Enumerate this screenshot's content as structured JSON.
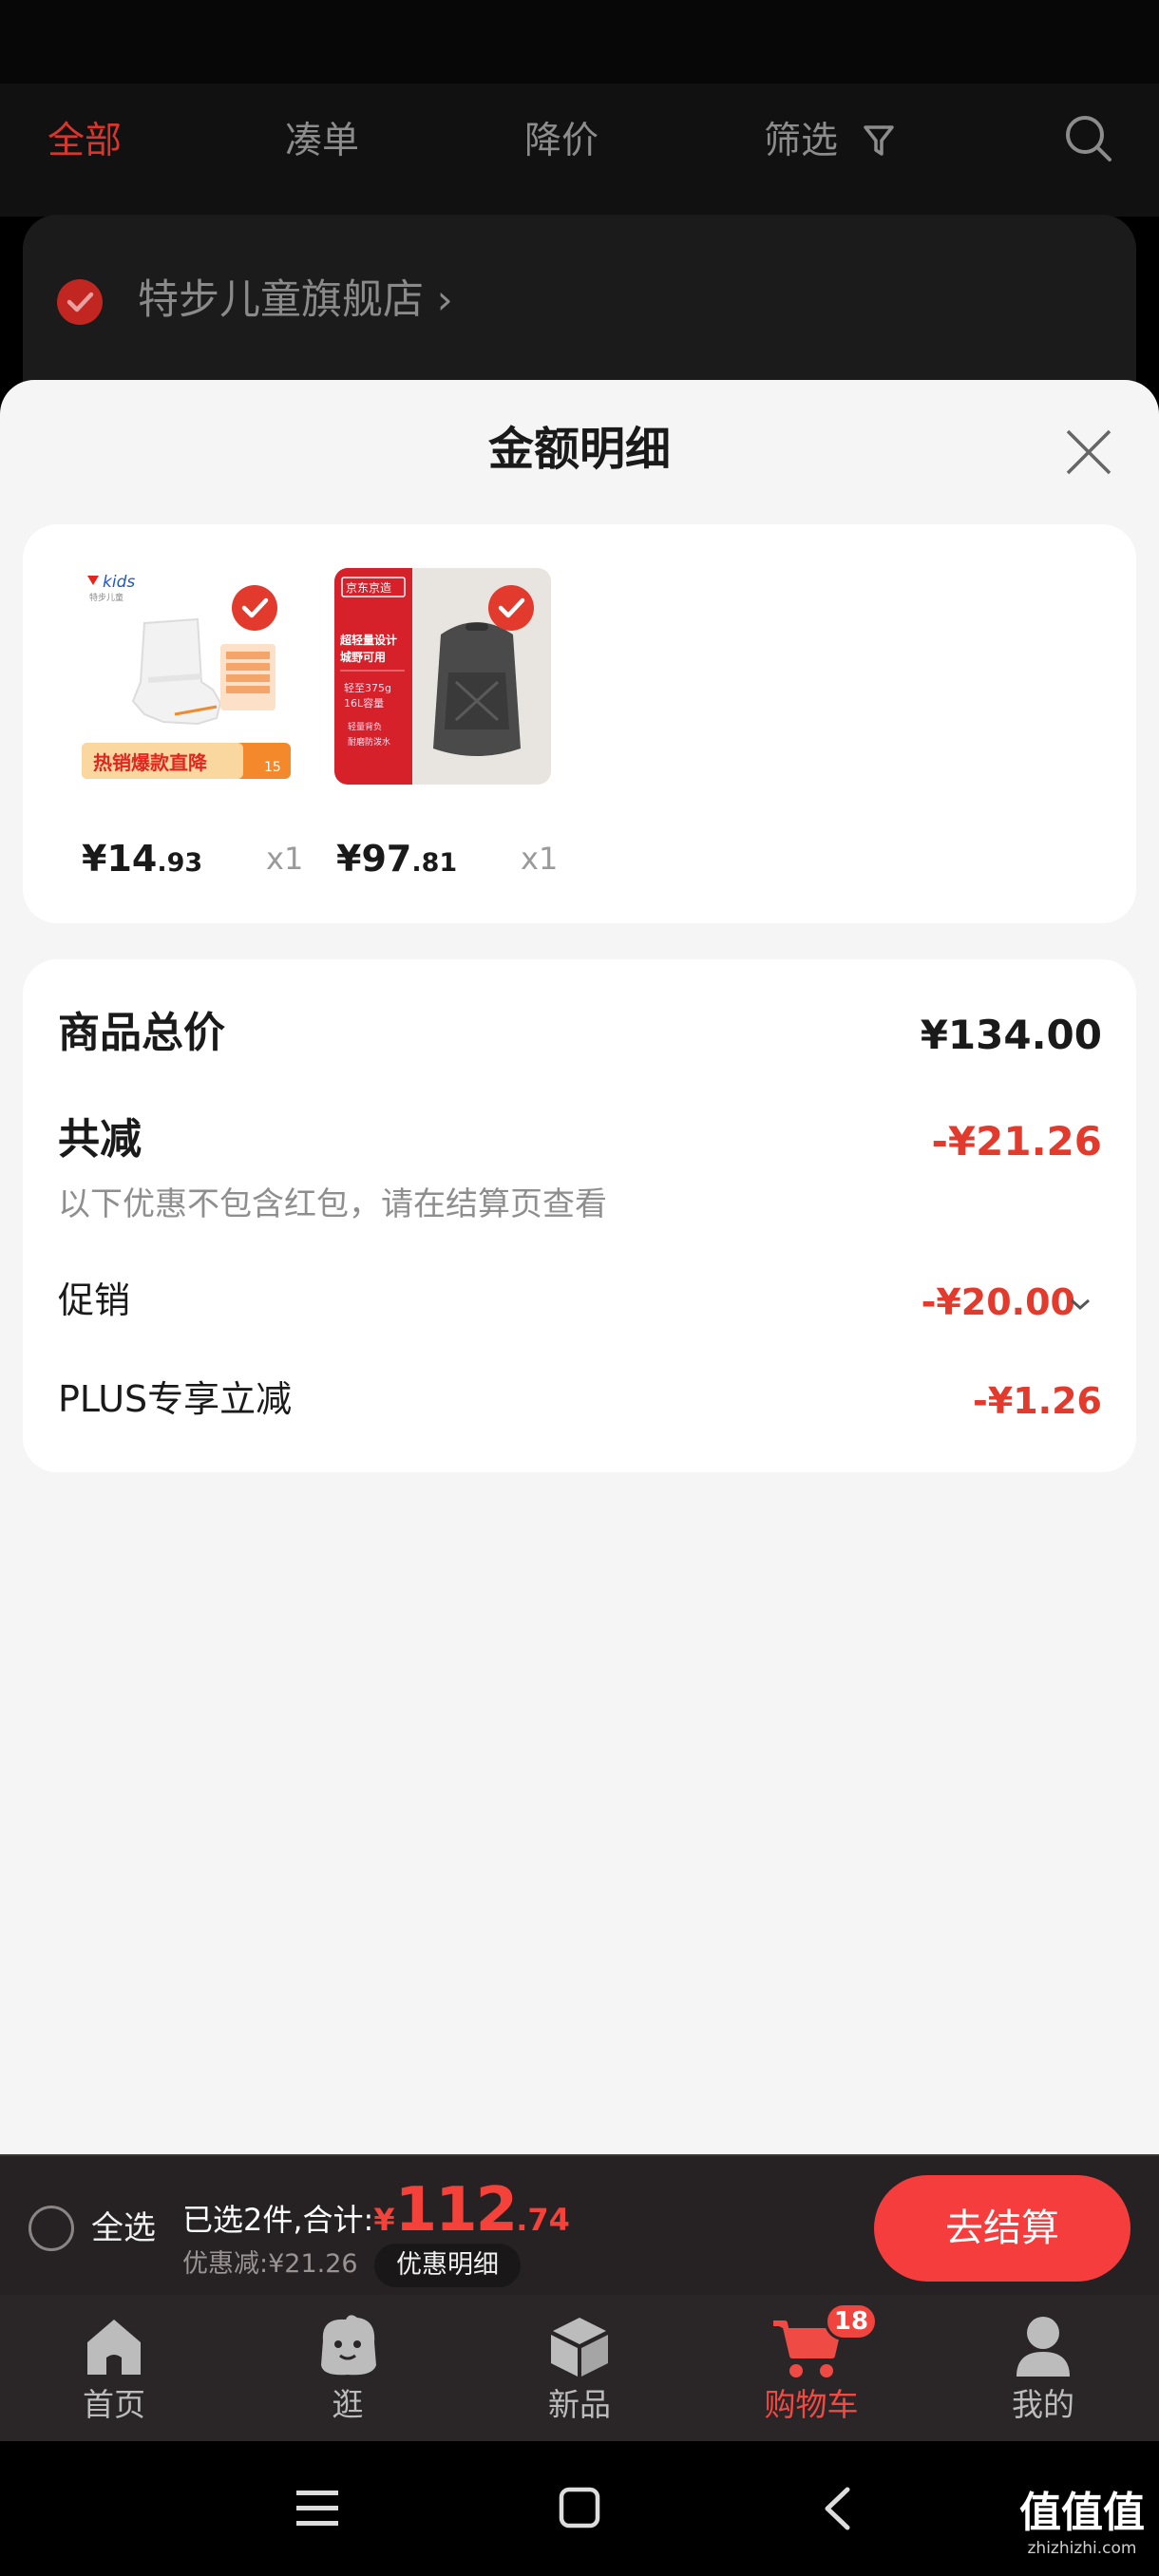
{
  "tabs": [
    {
      "label": "全部"
    },
    {
      "label": "凑单"
    },
    {
      "label": "降价"
    },
    {
      "label": "筛选"
    }
  ],
  "store": {
    "name": "特步儿童旗舰店"
  },
  "sheet": {
    "title": "金额明细"
  },
  "items": [
    {
      "price_int": "¥14",
      "price_dec": ".93",
      "qty": "x1",
      "thumb": {
        "brand": "kids",
        "brand_sub": "特步儿童",
        "banner": "热销爆款直降",
        "tag": "15"
      }
    },
    {
      "price_int": "¥97",
      "price_dec": ".81",
      "qty": "x1",
      "thumb": {
        "tag": "京东京造",
        "line1": "超轻量设计",
        "line2": "城野可用",
        "line3": "轻至375g",
        "line4": "16L容量",
        "line5": "轻量背负",
        "line6": "耐磨防泼水"
      }
    }
  ],
  "summary": {
    "total_label": "商品总价",
    "total_value": "¥134.00",
    "discount_label": "共减",
    "discount_value": "-¥21.26",
    "note": "以下优惠不包含红包，请在结算页查看",
    "promo_label": "促销",
    "promo_value": "-¥20.00",
    "plus_label": "PLUS专享立减",
    "plus_value": "-¥1.26"
  },
  "footer": {
    "select_all": "全选",
    "selected_text": "已选2件,合计:",
    "currency": "¥",
    "amount_int": "112",
    "amount_dec": ".74",
    "discount_text": "优惠减:¥21.26",
    "detail_label": "优惠明细",
    "checkout_label": "去结算"
  },
  "nav": [
    {
      "label": "首页"
    },
    {
      "label": "逛"
    },
    {
      "label": "新品"
    },
    {
      "label": "购物车",
      "badge": "18"
    },
    {
      "label": "我的"
    }
  ],
  "watermark": {
    "text": "值值值",
    "sub": "zhizhizhi.com"
  },
  "colors": {
    "accent": "#e23a2d",
    "tab_active": "#d8352c",
    "checkout": "#f53d3d"
  }
}
